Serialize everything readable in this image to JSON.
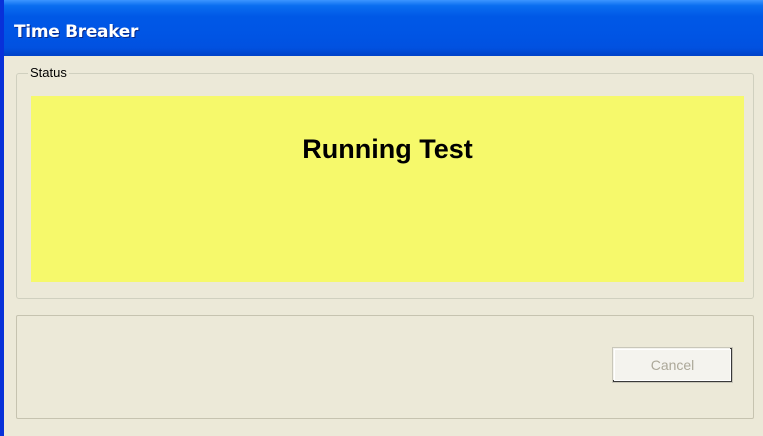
{
  "window": {
    "title": "Time Breaker"
  },
  "status_group": {
    "legend": "Status",
    "panel_color": "#f6f96b",
    "message": "Running Test"
  },
  "actions": {
    "cancel_label": "Cancel",
    "cancel_enabled": false
  },
  "colors": {
    "titlebar": "#0055e5",
    "window_bg": "#ece9d8"
  }
}
